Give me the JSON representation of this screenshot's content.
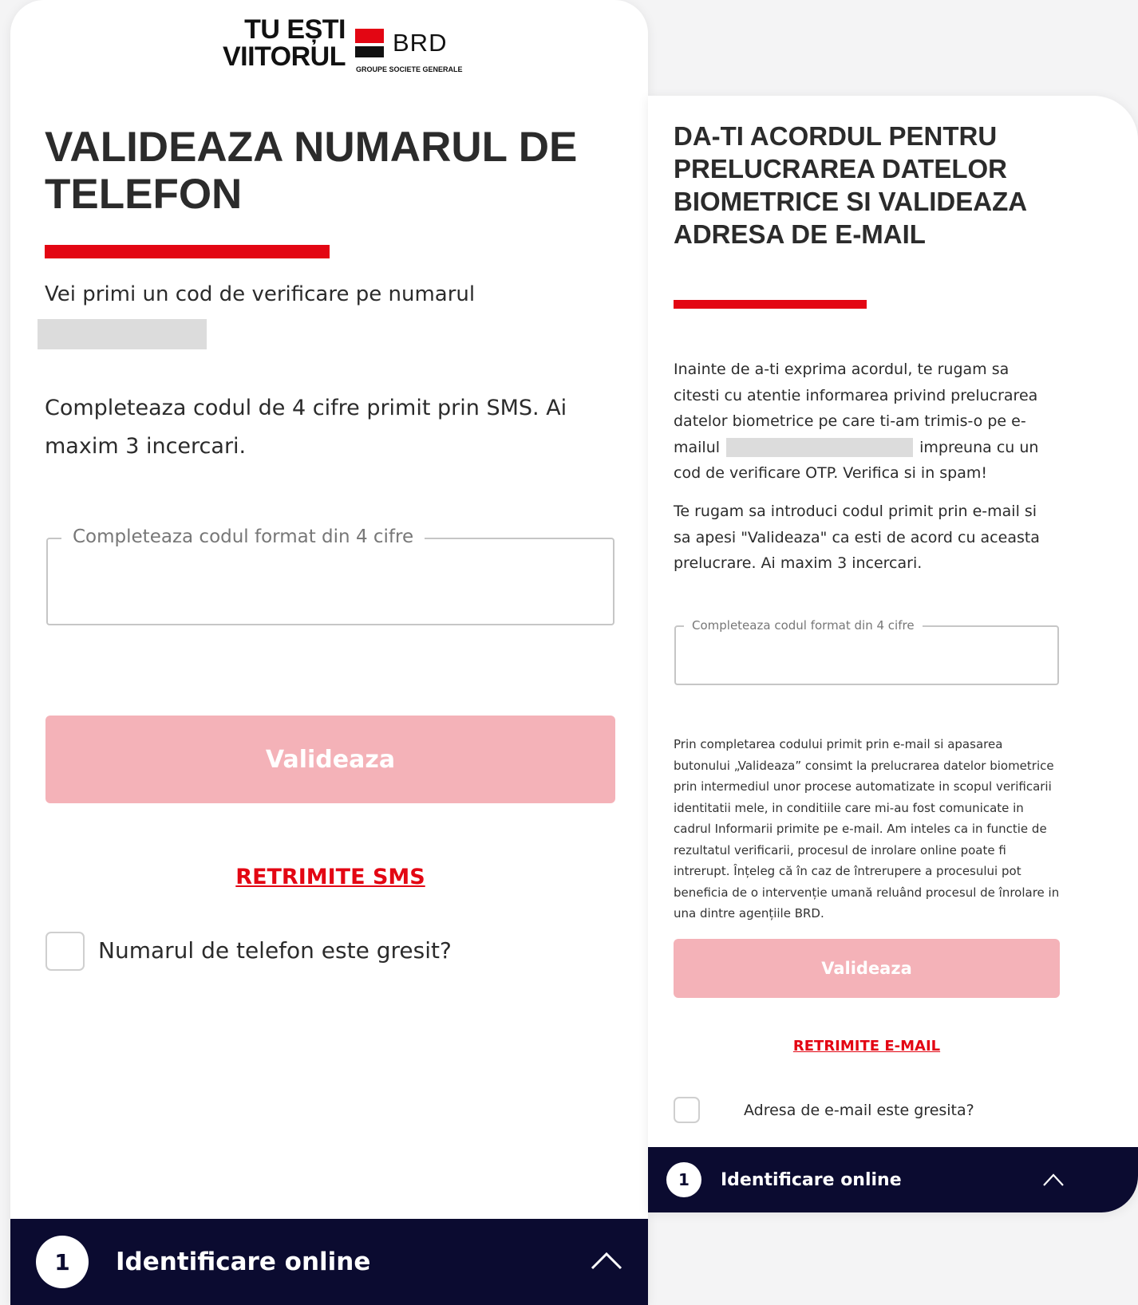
{
  "colors": {
    "brand_red": "#e30613",
    "button_disabled": "#f4b2b8",
    "navbar": "#0b0b30"
  },
  "logo": {
    "tagline_line1": "TU EȘTI",
    "tagline_line2": "VIITORUL",
    "brand": "BRD",
    "brand_sub": "GROUPE SOCIETE GENERALE"
  },
  "phone_screen": {
    "title": "VALIDEAZA NUMARUL DE TELEFON",
    "intro": "Vei primi un cod de verificare pe numarul",
    "instructions": "Completeaza codul de 4 cifre primit prin SMS. Ai maxim 3 incercari.",
    "code_field": {
      "label": "Completeaza codul format din 4 cifre",
      "value": ""
    },
    "validate_label": "Valideaza",
    "resend_label": "RETRIMITE SMS",
    "wrong_number_label": "Numarul de telefon este gresit?",
    "step_number": "1",
    "step_label": "Identificare online",
    "chevron_icon": "chevron-up-icon"
  },
  "email_screen": {
    "title": "DA-TI ACORDUL PENTRU PRELUCRAREA DATELOR BIOMETRICE SI VALIDEAZA ADRESA DE E-MAIL",
    "para1_start": "Inainte de a-ti exprima acordul, te rugam sa citesti cu atentie informarea privind prelucrarea datelor biometrice pe care ti-am trimis-o pe e-mailul",
    "para1_end": "impreuna cu un cod de verificare OTP. Verifica si in spam!",
    "para2": "Te rugam sa introduci codul primit prin e-mail si sa apesi \"Valideaza\" ca esti de acord cu aceasta prelucrare. Ai maxim 3 incercari.",
    "code_field": {
      "label": "Completeaza codul format din 4 cifre",
      "value": ""
    },
    "consent_text": "Prin completarea codului primit prin e-mail si apasarea butonului „Valideaza” consimt la prelucrarea datelor biometrice prin intermediul unor procese automatizate in scopul verificarii identitatii mele, in conditiile care mi-au fost comunicate in cadrul Informarii primite pe e-mail. Am inteles ca in functie de rezultatul verificarii, procesul de inrolare online poate fi intrerupt. Înțeleg că în caz de întrerupere a procesului pot beneficia de o intervenție umană reluând procesul de înrolare in una dintre agențiile BRD.",
    "validate_label": "Valideaza",
    "resend_label": "RETRIMITE E-MAIL",
    "wrong_email_label": "Adresa de e-mail este gresita?",
    "step_number": "1",
    "step_label": "Identificare online",
    "chevron_icon": "chevron-up-icon"
  }
}
